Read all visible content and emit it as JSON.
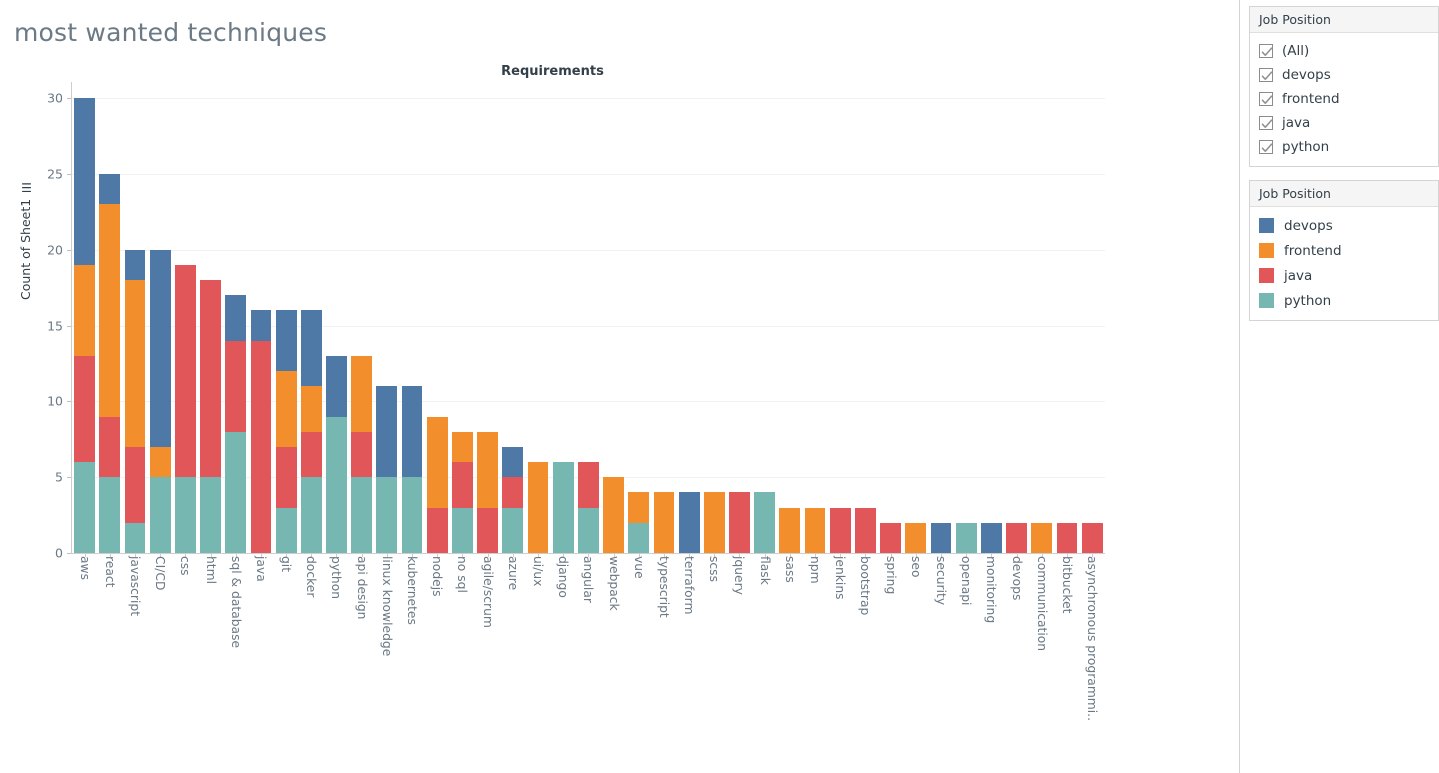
{
  "dashboard": {
    "title": "most wanted techniques"
  },
  "chart": {
    "title": "Requirements",
    "yaxis_label": "Count of Sheet1",
    "sort_icon": "sort-descending-icon"
  },
  "filter_panel": {
    "header": "Job Position",
    "items": [
      {
        "label": "(All)",
        "checked": true
      },
      {
        "label": "devops",
        "checked": true
      },
      {
        "label": "frontend",
        "checked": true
      },
      {
        "label": "java",
        "checked": true
      },
      {
        "label": "python",
        "checked": true
      }
    ]
  },
  "legend_panel": {
    "header": "Job Position",
    "items": [
      {
        "label": "devops",
        "color": "#4e79a7"
      },
      {
        "label": "frontend",
        "color": "#f28e2b"
      },
      {
        "label": "java",
        "color": "#e15759"
      },
      {
        "label": "python",
        "color": "#76b7b2"
      }
    ]
  },
  "chart_data": {
    "type": "bar",
    "subtype": "stacked-vertical",
    "title": "Requirements",
    "xlabel": "",
    "ylabel": "Count of Sheet1",
    "ylim": [
      0,
      30
    ],
    "yticks": [
      0,
      5,
      10,
      15,
      20,
      25,
      30
    ],
    "grid": true,
    "legend_position": "right",
    "stack_order_bottom_to_top": [
      "python",
      "java",
      "frontend",
      "devops"
    ],
    "colors": {
      "devops": "#4e79a7",
      "frontend": "#f28e2b",
      "java": "#e15759",
      "python": "#76b7b2"
    },
    "categories": [
      "aws",
      "react",
      "javascript",
      "CI/CD",
      "css",
      "html",
      "sql & database",
      "java",
      "git",
      "docker",
      "python",
      "api design",
      "linux knowledge",
      "kubernetes",
      "nodejs",
      "no sql",
      "agile/scrum",
      "azure",
      "ui/ux",
      "django",
      "angular",
      "webpack",
      "vue",
      "typescript",
      "terraform",
      "scss",
      "jquery",
      "flask",
      "sass",
      "npm",
      "jenkins",
      "bootstrap",
      "spring",
      "seo",
      "security",
      "openapi",
      "monitoring",
      "devops",
      "communication",
      "bitbucket",
      "asynchronous programmi.."
    ],
    "series": [
      {
        "name": "python",
        "color": "#76b7b2",
        "values": [
          6,
          5,
          2,
          5,
          5,
          5,
          8,
          0,
          3,
          5,
          9,
          5,
          5,
          5,
          0,
          3,
          0,
          3,
          0,
          6,
          3,
          0,
          2,
          0,
          0,
          0,
          0,
          4,
          0,
          0,
          0,
          0,
          0,
          0,
          0,
          2,
          0,
          0,
          0,
          0,
          0
        ]
      },
      {
        "name": "java",
        "color": "#e15759",
        "values": [
          7,
          4,
          5,
          0,
          14,
          13,
          6,
          14,
          4,
          3,
          0,
          3,
          0,
          0,
          3,
          3,
          3,
          2,
          0,
          0,
          3,
          0,
          0,
          0,
          0,
          0,
          4,
          0,
          0,
          0,
          3,
          3,
          2,
          0,
          0,
          0,
          0,
          2,
          0,
          2,
          2
        ]
      },
      {
        "name": "frontend",
        "color": "#f28e2b",
        "values": [
          6,
          14,
          11,
          2,
          0,
          0,
          0,
          0,
          5,
          3,
          0,
          5,
          0,
          0,
          6,
          2,
          5,
          0,
          6,
          0,
          0,
          5,
          2,
          4,
          0,
          4,
          0,
          0,
          3,
          3,
          0,
          0,
          0,
          2,
          0,
          0,
          0,
          0,
          2,
          0,
          0
        ]
      },
      {
        "name": "devops",
        "color": "#4e79a7",
        "values": [
          11,
          2,
          2,
          13,
          0,
          0,
          3,
          2,
          4,
          5,
          4,
          0,
          6,
          6,
          0,
          0,
          0,
          2,
          0,
          0,
          0,
          0,
          0,
          0,
          4,
          0,
          0,
          0,
          0,
          0,
          0,
          0,
          0,
          0,
          2,
          0,
          2,
          0,
          0,
          0,
          0
        ]
      }
    ],
    "totals": [
      30,
      25,
      20,
      20,
      19,
      18,
      17,
      16,
      16,
      16,
      13,
      13,
      11,
      11,
      9,
      8,
      8,
      7,
      6,
      6,
      6,
      5,
      4,
      4,
      4,
      4,
      4,
      4,
      3,
      3,
      3,
      3,
      2,
      2,
      2,
      2,
      2,
      2,
      2,
      2,
      2
    ]
  }
}
